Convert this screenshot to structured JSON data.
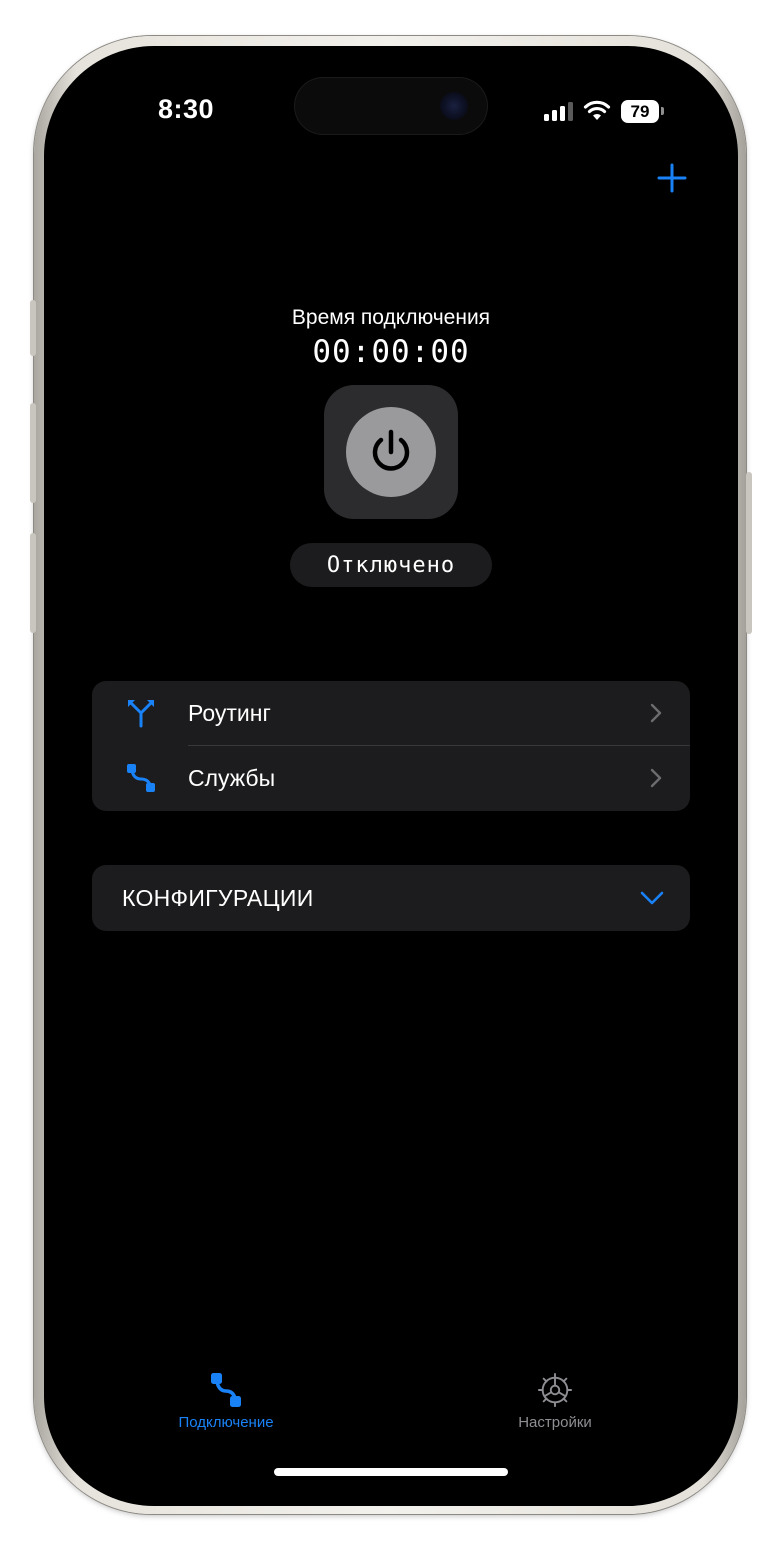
{
  "status_bar": {
    "time": "8:30",
    "battery": "79"
  },
  "header": {
    "add_icon": "plus-icon"
  },
  "connection": {
    "label": "Время подключения",
    "timer": "00:00:00",
    "power_icon": "power-icon",
    "status": "Отключено"
  },
  "menu": {
    "items": [
      {
        "label": "Роутинг",
        "icon": "routing-icon"
      },
      {
        "label": "Службы",
        "icon": "services-icon"
      }
    ]
  },
  "config": {
    "label": "КОНФИГУРАЦИИ",
    "icon": "chevron-down-icon"
  },
  "tabbar": {
    "tabs": [
      {
        "label": "Подключение",
        "icon": "connection-icon",
        "active": true
      },
      {
        "label": "Настройки",
        "icon": "gear-icon",
        "active": false
      }
    ]
  },
  "colors": {
    "accent": "#1a82f7",
    "inactive": "#8e8e93",
    "card": "#1c1c1e",
    "tile": "#2c2c2e",
    "power_circle": "#9a9a9d"
  }
}
